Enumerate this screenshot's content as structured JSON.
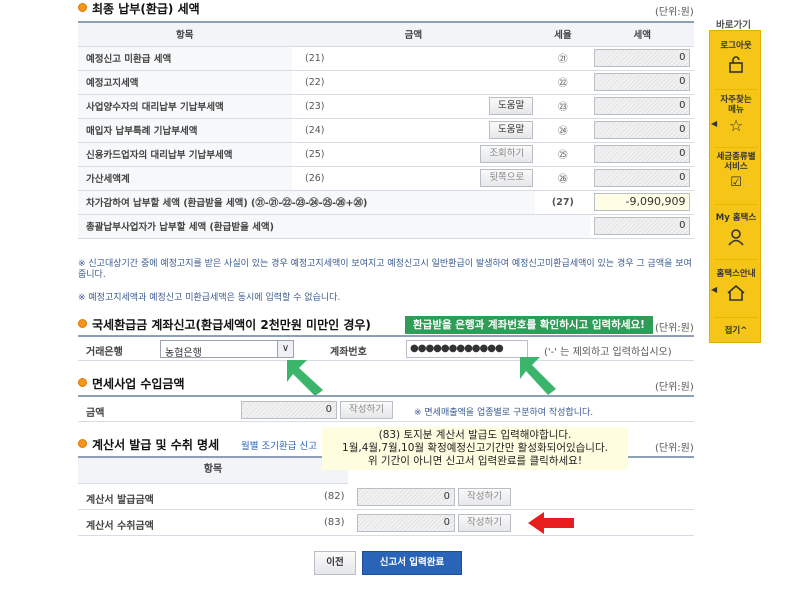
{
  "section1": {
    "title": "최종 납부(환급) 세액",
    "unit": "(단위:원)",
    "headers": {
      "item": "항목",
      "amount": "금액",
      "rate": "세율",
      "tax": "세액"
    },
    "rows": [
      {
        "label": "예정신고 미환급 세액",
        "code": "(21)",
        "circle": "㉑",
        "value": "0"
      },
      {
        "label": "예정고지세액",
        "code": "(22)",
        "circle": "㉒",
        "value": "0"
      },
      {
        "label": "사업양수자의 대리납부 기납부세액",
        "code": "(23)",
        "button": "도움말",
        "circle": "㉓",
        "value": "0"
      },
      {
        "label": "매입자 납부특례 기납부세액",
        "code": "(24)",
        "button": "도움말",
        "circle": "㉔",
        "value": "0"
      },
      {
        "label": "신용카드업자의 대리납부 기납부세액",
        "code": "(25)",
        "button": "조회하기",
        "circle": "㉕",
        "value": "0"
      },
      {
        "label": "가산세액계",
        "code": "(26)",
        "button": "뒷쪽으로",
        "circle": "㉖",
        "value": "0"
      }
    ],
    "subtotal_label": "차가감하여 납부할 세액 (환급받을 세액) (㉑-㉑-㉒-㉓-㉔-㉕-㉖+㉖)",
    "subtotal_code": "(27)",
    "subtotal_value": "-9,090,909",
    "total_label": "총괄납부사업자가 납부할 세액 (환급받을 세액)",
    "total_value": "0",
    "note1": "※ 신고대상기간 중에 예정고지를 받은 사실이 있는 경우 예정고지세액이 보여지고 예정신고시 일반환급이 발생하여 예정신고미환급세액이 있는 경우 그 금액을 보여줍니다.",
    "note2": "※ 예정고지세액과 예정신고 미환급세액은 동시에 입력할 수 없습니다."
  },
  "section2": {
    "title": "국세환급금 계좌신고(환급세액이 2천만원 미만인 경우)",
    "unit": "(단위:원)",
    "bank_label": "거래은행",
    "bank_value": "농협은행",
    "account_label": "계좌번호",
    "account_value": "●●●●●●●●●●●●",
    "account_hint": "('-' 는 제외하고 입력하십시오)",
    "banner": "환급받을 은행과 계좌번호를 확인하시고 입력하세요!"
  },
  "section3": {
    "title": "면세사업 수입금액",
    "unit": "(단위:원)",
    "label": "금액",
    "value": "0",
    "button": "작성하기",
    "note": "※ 면세매출액을 업종별로 구분하여 작성합니다."
  },
  "section4": {
    "title": "계산서 발급 및 수취 명세",
    "subtitle": "월별 조기환급 신고",
    "unit": "(단위:원)",
    "header_item": "항목",
    "rows": [
      {
        "label": "계산서 발급금액",
        "code": "(82)",
        "value": "0",
        "button": "작성하기"
      },
      {
        "label": "계산서 수취금액",
        "code": "(83)",
        "value": "0",
        "button": "작성하기"
      }
    ],
    "tooltip": [
      "(83) 토지분 계산서 발급도 입력해야합니다.",
      "1월,4월,7월,10월 확정예정신고기간만 활성화되어있습니다.",
      "위 기간이 아니면 신고서 입력완료를 클릭하세요!"
    ]
  },
  "footer": {
    "prev": "이전",
    "complete": "신고서 입력완료"
  },
  "sidebar": {
    "title": "바로가기",
    "items": [
      {
        "label": "로그아웃",
        "icon": "lock-icon"
      },
      {
        "label": "자주찾는 메뉴",
        "icon": "star-icon"
      },
      {
        "label": "세금종류별 서비스",
        "icon": "checkbox-icon"
      },
      {
        "label": "My 홈택스",
        "icon": "person-icon"
      },
      {
        "label": "홈택스안내",
        "icon": "home-icon"
      }
    ],
    "collapse": "접기^"
  },
  "colors": {
    "accent_green": "#2f9c57",
    "accent_orange": "#f7941d",
    "sidebar_yellow": "#f5c518",
    "primary_blue": "#2a64b8",
    "arrow_red": "#e81e1e"
  }
}
